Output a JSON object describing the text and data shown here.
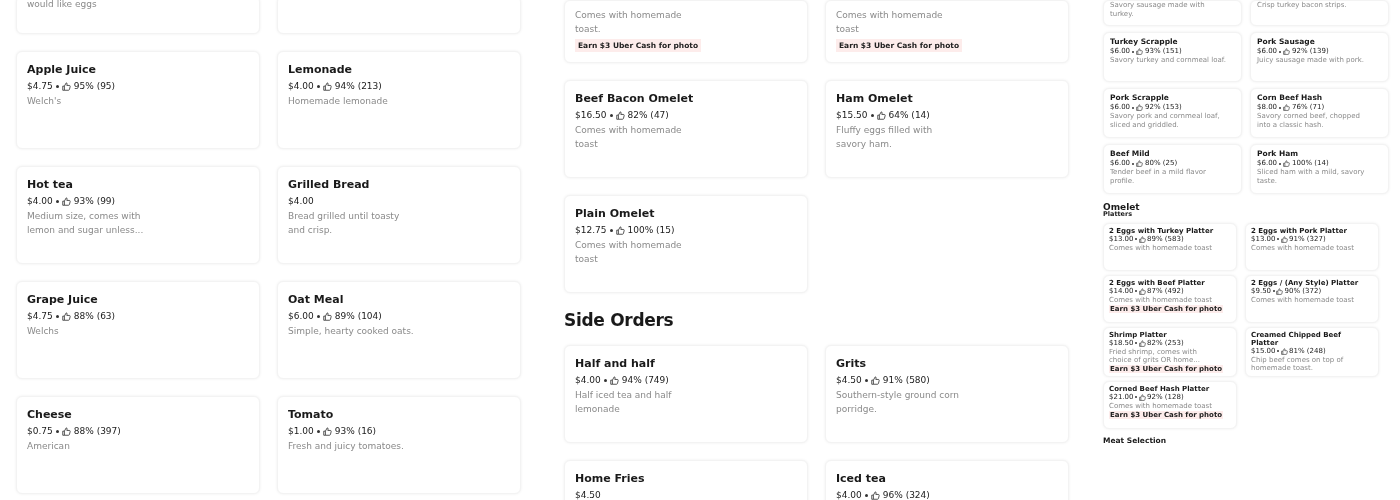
{
  "panels": [
    {
      "kind": "left",
      "sections": [
        {
          "items": [
            {
              "kind": "cut",
              "description": "would like eggs"
            },
            {
              "kind": "cut"
            },
            {
              "kind": "full",
              "name": "Apple Juice",
              "price": "$4.75",
              "rating": "95% (95)",
              "description": "Welch's"
            },
            {
              "kind": "full",
              "name": "Lemonade",
              "price": "$4.00",
              "rating": "94% (213)",
              "description": "Homemade lemonade"
            },
            {
              "kind": "full",
              "name": "Hot tea",
              "price": "$4.00",
              "rating": "93% (99)",
              "description": "Medium size, comes with lemon and sugar unless..."
            },
            {
              "kind": "full",
              "name": "Grilled Bread",
              "price": "$4.00",
              "description": "Bread grilled until toasty and crisp."
            },
            {
              "kind": "full",
              "name": "Grape Juice",
              "price": "$4.75",
              "rating": "88% (63)",
              "description": "Welchs"
            },
            {
              "kind": "full",
              "name": "Oat Meal",
              "price": "$6.00",
              "rating": "89% (104)",
              "description": "Simple, hearty cooked oats."
            },
            {
              "kind": "full",
              "name": "Cheese",
              "price": "$0.75",
              "rating": "88% (397)",
              "description": "American"
            },
            {
              "kind": "full",
              "name": "Tomato",
              "price": "$1.00",
              "rating": "93% (16)",
              "description": "Fresh and juicy tomatoes."
            }
          ]
        }
      ]
    },
    {
      "kind": "middle",
      "sections": [
        {
          "items": [
            {
              "kind": "cut",
              "description": "Comes with homemade toast.",
              "badge": "Earn $3 Uber Cash for photo"
            },
            {
              "kind": "cut",
              "description": "Comes with homemade toast",
              "badge": "Earn $3 Uber Cash for photo"
            },
            {
              "kind": "full",
              "name": "Beef Bacon Omelet",
              "price": "$16.50",
              "rating": "82% (47)",
              "description": "Comes with homemade toast"
            },
            {
              "kind": "full",
              "name": "Ham Omelet",
              "price": "$15.50",
              "rating": "64% (14)",
              "description": "Fluffy eggs filled with savory ham."
            },
            {
              "kind": "full",
              "name": "Plain Omelet",
              "price": "$12.75",
              "rating": "100% (15)",
              "description": "Comes with homemade toast"
            }
          ]
        },
        {
          "heading": "Side Orders",
          "items": [
            {
              "kind": "full",
              "name": "Half and half",
              "price": "$4.00",
              "rating": "94% (749)",
              "description": "Half iced tea and half lemonade"
            },
            {
              "kind": "full",
              "name": "Grits",
              "price": "$4.50",
              "rating": "91% (580)",
              "description": "Southern-style ground corn porridge."
            },
            {
              "kind": "full",
              "name": "Home Fries",
              "price": "$4.50"
            },
            {
              "kind": "full",
              "name": "Iced tea",
              "price": "$4.00",
              "rating": "96% (324)"
            }
          ]
        }
      ]
    },
    {
      "kind": "right",
      "sections": [
        {
          "items": [
            {
              "kind": "cut",
              "description": "Savory sausage made with turkey."
            },
            {
              "kind": "cut",
              "description": "Crisp turkey bacon strips."
            },
            {
              "kind": "full",
              "name": "Turkey Scrapple",
              "price": "$6.00",
              "rating": "93% (151)",
              "description": "Savory turkey and cornmeal loaf."
            },
            {
              "kind": "full",
              "name": "Pork Sausage",
              "price": "$6.00",
              "rating": "92% (139)",
              "description": "Juicy sausage made with pork."
            },
            {
              "kind": "full",
              "name": "Pork Scrapple",
              "price": "$6.00",
              "rating": "92% (153)",
              "description": "Savory pork and cornmeal loaf, sliced and griddled."
            },
            {
              "kind": "full",
              "name": "Corn Beef Hash",
              "price": "$8.00",
              "rating": "76% (71)",
              "description": "Savory corned beef, chopped into a classic hash."
            },
            {
              "kind": "full",
              "name": "Beef Mild",
              "price": "$6.00",
              "rating": "80% (25)",
              "description": "Tender beef in a mild flavor profile."
            },
            {
              "kind": "full",
              "name": "Pork Ham",
              "price": "$6.00",
              "rating": "100% (14)",
              "description": "Sliced ham with a mild, savory taste."
            }
          ]
        },
        {
          "heading": "Omelet",
          "subheading": "Platters",
          "items": [
            {
              "kind": "full",
              "name": "2 Eggs with Turkey Platter",
              "price": "$13.00",
              "rating": "89% (583)",
              "description": "Comes with homemade toast"
            },
            {
              "kind": "full",
              "name": "2 Eggs with Pork Platter",
              "price": "$13.00",
              "rating": "91% (327)",
              "description": "Comes with homemade toast"
            },
            {
              "kind": "full",
              "name": "2 Eggs with Beef Platter",
              "price": "$14.00",
              "rating": "87% (492)",
              "description": "Comes with homemade toast",
              "badge": "Earn $3 Uber Cash for photo"
            },
            {
              "kind": "full",
              "name": "2 Eggs / (Any Style) Platter",
              "price": "$9.50",
              "rating": "90% (372)",
              "description": "Comes with homemade toast"
            },
            {
              "kind": "full",
              "name": "Shrimp Platter",
              "price": "$18.50",
              "rating": "82% (253)",
              "description": "Fried shrimp, comes with choice of grits OR home...",
              "badge": "Earn $3 Uber Cash for photo"
            },
            {
              "kind": "full",
              "name": "Creamed Chipped Beef Platter",
              "price": "$15.00",
              "rating": "81% (248)",
              "description": "Chip beef comes on top of homemade toast."
            },
            {
              "kind": "full",
              "name": "Corned Beef Hash Platter",
              "price": "$21.00",
              "rating": "92% (128)",
              "description": "Comes with homemade toast",
              "badge": "Earn $3 Uber Cash for photo"
            }
          ]
        },
        {
          "heading": "Meat Selection"
        }
      ]
    }
  ]
}
